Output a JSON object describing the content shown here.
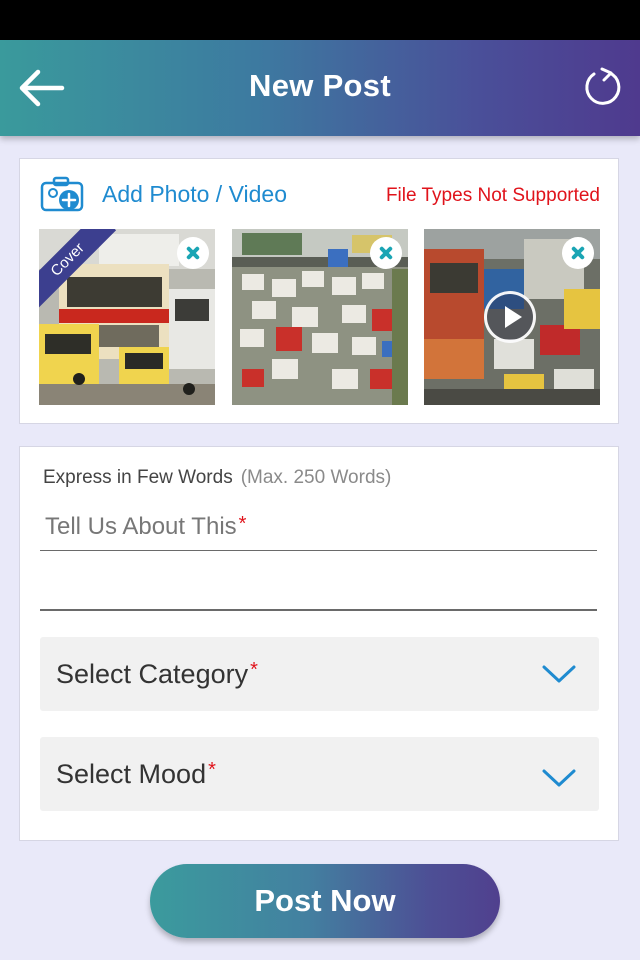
{
  "header": {
    "title": "New Post",
    "back_icon": "arrow-left-icon",
    "refresh_icon": "refresh-icon"
  },
  "media": {
    "add_label": "Add Photo / Video",
    "error_text": "File Types Not Supported",
    "camera_icon": "camera-plus-icon",
    "items": [
      {
        "type": "photo",
        "badge": "Cover",
        "scene": "buses and traffic on city street"
      },
      {
        "type": "photo",
        "badge": "",
        "scene": "dense traffic jam aerial view"
      },
      {
        "type": "video",
        "badge": "",
        "scene": "trucks and cars in traffic"
      }
    ]
  },
  "form": {
    "label": "Express in Few Words",
    "label_hint": "(Max. 250 Words)",
    "placeholder": "Tell Us About This",
    "required_mark": "*",
    "category_label": "Select Category",
    "mood_label": "Select Mood"
  },
  "actions": {
    "post_label": "Post Now"
  },
  "colors": {
    "accent_blue": "#1f8bd0",
    "error_red": "#e0131b",
    "teal": "#1aa5b4",
    "gradient_start": "#3a9a9c",
    "gradient_end": "#4f3a8e"
  }
}
